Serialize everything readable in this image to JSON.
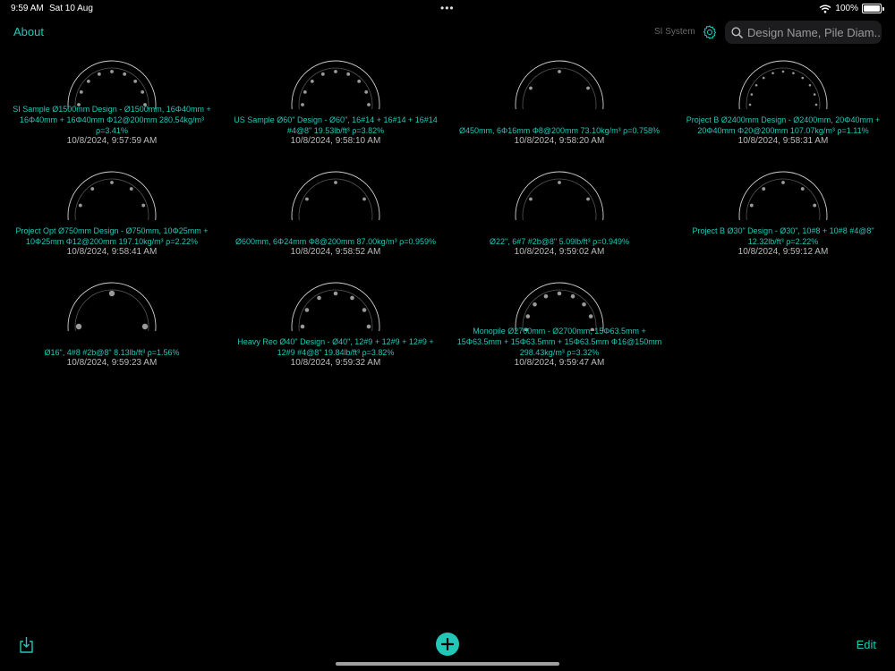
{
  "status_bar": {
    "time": "9:59 AM",
    "date": "Sat 10 Aug",
    "battery": "100%"
  },
  "nav": {
    "about_label": "About",
    "unit_system": "SI System",
    "search_placeholder": "Design Name, Pile Diam..."
  },
  "designs": [
    {
      "title": "SI Sample Ø1500mm Design - Ø1500mm, 16Φ40mm + 16Φ40mm + 16Φ40mm Φ12@200mm 280.54kg/m³ ρ=3.41%",
      "date": "10/8/2024, 9:57:59 AM",
      "bars": 16,
      "bar_size": "small"
    },
    {
      "title": "US Sample Ø60\" Design - Ø60\", 16#14 + 16#14 + 16#14 #4@8\" 19.53lb/ft³ ρ=3.82%",
      "date": "10/8/2024, 9:58:10 AM",
      "bars": 16,
      "bar_size": "small"
    },
    {
      "title": "Ø450mm, 6Φ16mm Φ8@200mm 73.10kg/m³ ρ=0.758%",
      "date": "10/8/2024, 9:58:20 AM",
      "bars": 6,
      "bar_size": "small"
    },
    {
      "title": "Project B Ø2400mm Design - Ø2400mm, 20Φ40mm + 20Φ40mm Φ20@200mm 107.07kg/m³ ρ=1.11%",
      "date": "10/8/2024, 9:58:31 AM",
      "bars": 20,
      "bar_size": "tiny"
    },
    {
      "title": "Project Opt Ø750mm Design - Ø750mm, 10Φ25mm + 10Φ25mm Φ12@200mm 197.10kg/m³ ρ=2.22%",
      "date": "10/8/2024, 9:58:41 AM",
      "bars": 10,
      "bar_size": "small"
    },
    {
      "title": "Ø600mm, 6Φ24mm Φ8@200mm 87.00kg/m³ ρ=0.959%",
      "date": "10/8/2024, 9:58:52 AM",
      "bars": 6,
      "bar_size": "small"
    },
    {
      "title": "Ø22\", 6#7 #2b@8\" 5.09lb/ft³ ρ=0.949%",
      "date": "10/8/2024, 9:59:02 AM",
      "bars": 6,
      "bar_size": "small"
    },
    {
      "title": "Project B Ø30\" Design - Ø30\", 10#8 + 10#8 #4@8\" 12.32lb/ft³ ρ=2.22%",
      "date": "10/8/2024, 9:59:12 AM",
      "bars": 10,
      "bar_size": "small"
    },
    {
      "title": "Ø16\", 4#8 #2b@8\" 8.13lb/ft³ ρ=1.56%",
      "date": "10/8/2024, 9:59:23 AM",
      "bars": 4,
      "bar_size": "large"
    },
    {
      "title": "Heavy Reo Ø40\" Design - Ø40\", 12#9 + 12#9 + 12#9 + 12#9 #4@8\" 19.84lb/ft³ ρ=3.82%",
      "date": "10/8/2024, 9:59:32 AM",
      "bars": 12,
      "bar_size": "medium"
    },
    {
      "title": "Monopile Ø2700mm - Ø2700mm, 15Φ63.5mm + 15Φ63.5mm + 15Φ63.5mm + 15Φ63.5mm Φ16@150mm 298.43kg/m³ ρ=3.32%",
      "date": "10/8/2024, 9:59:47 AM",
      "bars": 15,
      "bar_size": "medium"
    }
  ],
  "toolbar": {
    "edit_label": "Edit"
  },
  "colors": {
    "accent": "#22c7b8",
    "background": "#000000"
  }
}
